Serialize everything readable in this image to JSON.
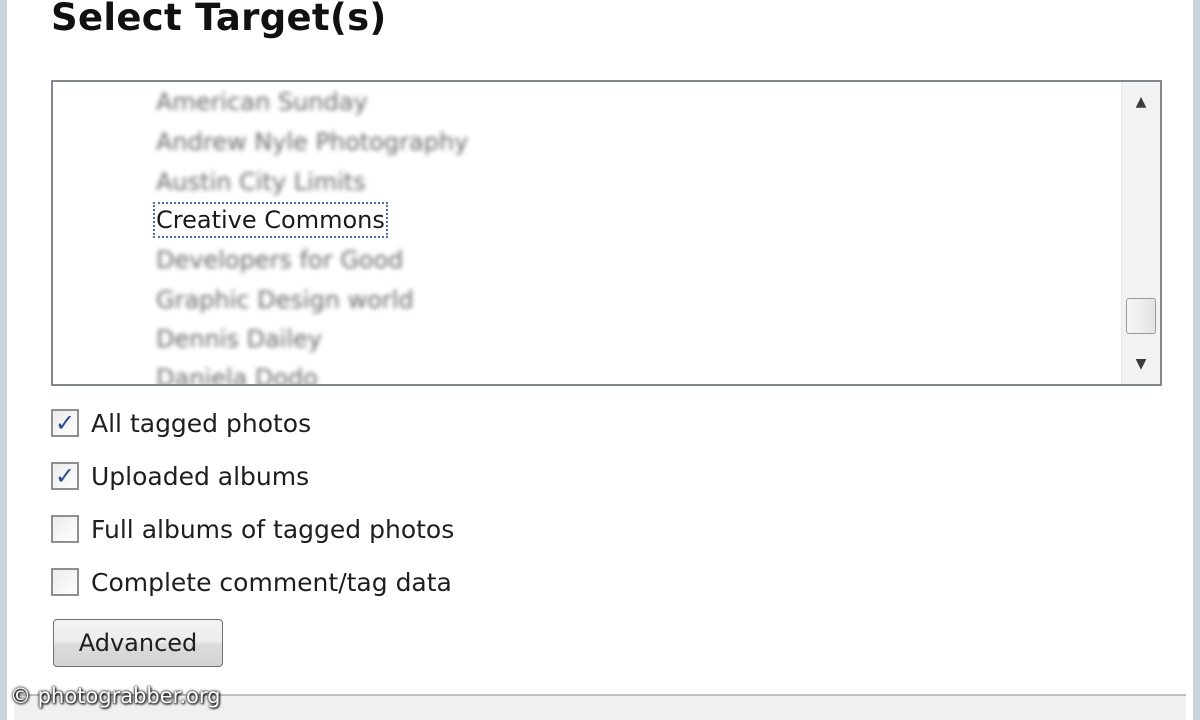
{
  "dialog": {
    "heading": "Select Target(s)"
  },
  "target_list": {
    "items": [
      {
        "label": "American Sunday",
        "state": "obscured"
      },
      {
        "label": "Andrew Nyle Photography",
        "state": "obscured"
      },
      {
        "label": "Austin City Limits",
        "state": "obscured"
      },
      {
        "label": "Creative Commons",
        "state": "focused"
      },
      {
        "label": "Developers for Good",
        "state": "obscured"
      },
      {
        "label": "Graphic Design world",
        "state": "obscured"
      },
      {
        "label": "Dennis Dailey",
        "state": "obscured"
      },
      {
        "label": "Daniela Dodo",
        "state": "obscured"
      }
    ],
    "scroll_up_icon": "triangle-up-icon",
    "scroll_down_icon": "triangle-down-icon"
  },
  "options": [
    {
      "label": "All tagged photos",
      "checked": true
    },
    {
      "label": "Uploaded albums",
      "checked": true
    },
    {
      "label": "Full albums of tagged photos",
      "checked": false
    },
    {
      "label": "Complete comment/tag data",
      "checked": false
    }
  ],
  "buttons": {
    "advanced_label": "Advanced"
  },
  "watermark": {
    "text": "© photograbber.org"
  },
  "colors": {
    "check_mark": "#2b4f8f",
    "focus_outline": "#4a6ea8",
    "window_border": "#c8d3de"
  }
}
